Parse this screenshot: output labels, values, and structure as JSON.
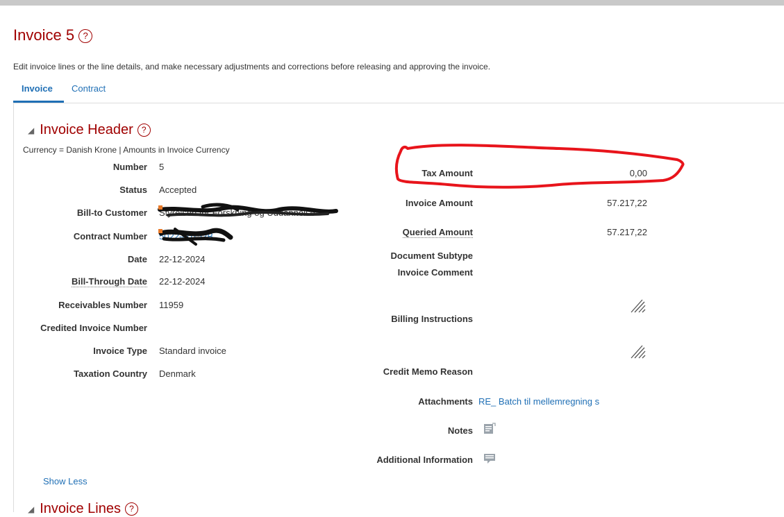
{
  "page": {
    "title": "Invoice 5",
    "instructions": "Edit invoice lines or the line details, and make necessary adjustments and corrections before releasing and approving the invoice."
  },
  "tabs": [
    {
      "label": "Invoice",
      "active": true
    },
    {
      "label": "Contract",
      "active": false
    }
  ],
  "header": {
    "title": "Invoice Header",
    "currency_text": "Currency = Danish Krone | Amounts in Invoice Currency",
    "left_fields": [
      {
        "label": "Number",
        "value": "5"
      },
      {
        "label": "Status",
        "value": "Accepted"
      },
      {
        "label": "Bill-to Customer",
        "value": "Styrelsen for Forskning og Uddannelse"
      },
      {
        "label": "Contract Number",
        "value": "5022-00152B"
      },
      {
        "label": "Date",
        "value": "22-12-2024"
      },
      {
        "label": "Bill-Through Date",
        "value": "22-12-2024"
      },
      {
        "label": "Receivables Number",
        "value": "11959"
      },
      {
        "label": "Credited Invoice Number",
        "value": ""
      },
      {
        "label": "Invoice Type",
        "value": "Standard invoice"
      },
      {
        "label": "Taxation Country",
        "value": "Denmark"
      }
    ],
    "right_fields": {
      "tax_amount_label": "Tax Amount",
      "tax_amount_value": "0,00",
      "invoice_amount_label": "Invoice Amount",
      "invoice_amount_value": "57.217,22",
      "queried_amount_label": "Queried Amount",
      "queried_amount_value": "57.217,22",
      "document_subtype_label": "Document Subtype",
      "invoice_comment_label": "Invoice Comment",
      "billing_instructions_label": "Billing Instructions",
      "credit_memo_reason_label": "Credit Memo Reason",
      "attachments_label": "Attachments",
      "attachments_value": "RE_ Batch til mellemregning s",
      "notes_label": "Notes",
      "additional_info_label": "Additional Information"
    },
    "show_less": "Show Less"
  },
  "lines": {
    "title": "Invoice Lines"
  },
  "colors": {
    "title_red": "#a00000",
    "link_blue": "#1f6fb5",
    "annotation_red": "#e8141b"
  },
  "icons": [
    "help-icon",
    "collapse-triangle-icon",
    "resize-handle-icon",
    "notes-icon",
    "additional-info-icon"
  ]
}
